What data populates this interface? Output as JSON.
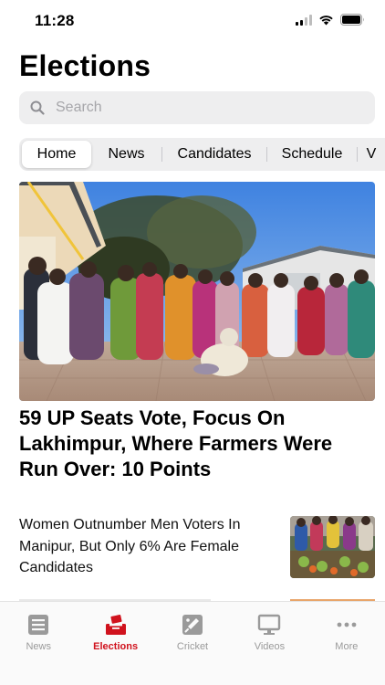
{
  "status_bar": {
    "time": "11:28"
  },
  "page": {
    "title": "Elections"
  },
  "search": {
    "placeholder": "Search"
  },
  "tabs": [
    {
      "label": "Home",
      "active": true
    },
    {
      "label": "News",
      "active": false
    },
    {
      "label": "Candidates",
      "active": false
    },
    {
      "label": "Schedule",
      "active": false
    },
    {
      "label": "V",
      "active": false
    }
  ],
  "top_story": {
    "headline": "59 UP Seats Vote, Focus On Lakhimpur, Where Farmers Were Run Over: 10 Points"
  },
  "second_story": {
    "headline": "Women Outnumber Men Voters In Manipur, But Only 6% Are Female Candidates"
  },
  "tab_bar": {
    "items": [
      {
        "label": "News",
        "icon": "newspaper-icon",
        "active": false
      },
      {
        "label": "Elections",
        "icon": "ballot-box-icon",
        "active": true
      },
      {
        "label": "Cricket",
        "icon": "cricket-bat-icon",
        "active": false
      },
      {
        "label": "Videos",
        "icon": "monitor-icon",
        "active": false
      },
      {
        "label": "More",
        "icon": "more-dots-icon",
        "active": false
      }
    ]
  },
  "colors": {
    "accent": "#d0121d",
    "inactive": "#9a9a9a",
    "search_bg": "#eeeeef"
  }
}
